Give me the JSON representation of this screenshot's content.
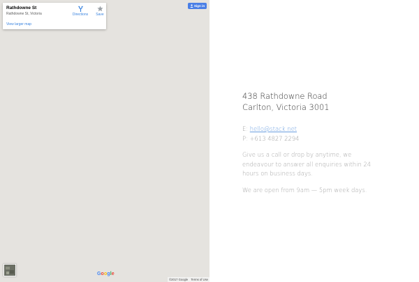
{
  "map": {
    "place_card": {
      "name": "Rathdowne St",
      "address": "Rathdowne St, Victoria",
      "directions_label": "Directions",
      "save_label": "Save",
      "larger_map_label": "View larger map"
    },
    "sign_in_label": "Sign in",
    "google_logo": [
      "G",
      "o",
      "o",
      "g",
      "l",
      "e"
    ],
    "attribution": {
      "copyright": "©2017 Google",
      "terms": "Terms of Use"
    },
    "colors": {
      "background": "#e5e3df",
      "link": "#3a84df",
      "sign_in": "#4a7fe6"
    }
  },
  "contact": {
    "address_line1": "438 Rathdowne Road",
    "address_line2": "Carlton, Victoria 3001",
    "email_prefix": "E: ",
    "email": "hello@stack.net",
    "phone": "P: +613 4827 2294",
    "availability": "Give us a call or drop by anytime, we endeavour to answer all enquiries within 24 hours on business days.",
    "hours": "We are open from 9am — 5pm week days."
  }
}
